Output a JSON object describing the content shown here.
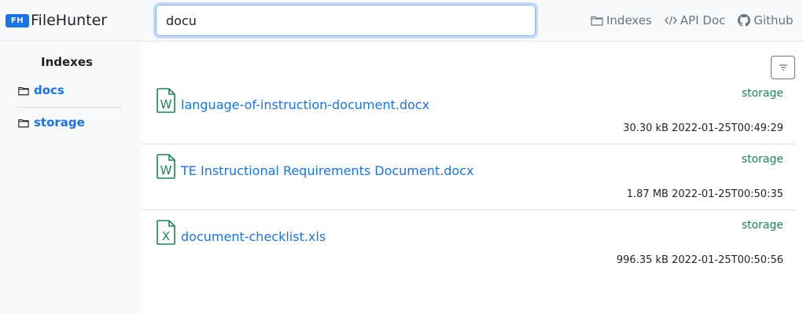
{
  "brand": {
    "badge": "FH",
    "name": "FileHunter"
  },
  "search": {
    "value": "docu"
  },
  "nav": {
    "indexes": "Indexes",
    "api_doc": "API Doc",
    "github": "Github"
  },
  "sidebar": {
    "title": "Indexes",
    "items": [
      {
        "label": "docs"
      },
      {
        "label": "storage"
      }
    ]
  },
  "results": [
    {
      "name": "language-of-instruction-document.docx",
      "index": "storage",
      "size": "30.30 kB",
      "date": "2022-01-25T00:49:29",
      "icon": "word-file-icon",
      "letter": "W"
    },
    {
      "name": "TE Instructional Requirements Document.docx",
      "index": "storage",
      "size": "1.87 MB",
      "date": "2022-01-25T00:50:35",
      "icon": "word-file-icon",
      "letter": "W"
    },
    {
      "name": "document-checklist.xls",
      "index": "storage",
      "size": "996.35 kB",
      "date": "2022-01-25T00:50:56",
      "icon": "excel-file-icon",
      "letter": "X"
    }
  ],
  "colors": {
    "accent": "#1a73e8",
    "index_tag": "#198754",
    "file_icon": "#198754"
  }
}
